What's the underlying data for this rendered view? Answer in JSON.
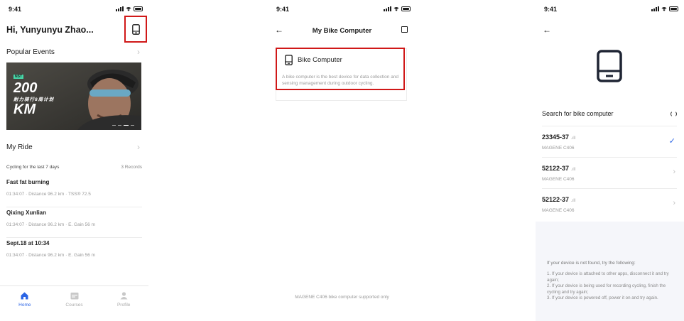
{
  "status": {
    "time": "9:41"
  },
  "home": {
    "greeting": "Hi, Yunyunyu Zhao...",
    "device_button_icon": "phone-device-icon",
    "popular_events": "Popular Events",
    "banner": {
      "tag": "NST",
      "big1": "200",
      "sub": "耐力骑行8周计划",
      "big2": "KM"
    },
    "my_ride": "My Ride",
    "cycling_summary": "Cycling for the last 7 days",
    "records": "3 Records",
    "rides": [
      {
        "title": "Fast fat burning",
        "detail": "01:34:07 · Distance 96.2 km · TSS® 72.5"
      },
      {
        "title": "Qixing Xunlian",
        "detail": "01:34:07 · Distance 96.2 km · E. Gain 56 m"
      },
      {
        "title": "Sept.18 at 10:34",
        "detail": "01:34:07 · Distance 96.2 km · E. Gain 56 m"
      }
    ],
    "tabs": [
      {
        "label": "Home",
        "icon": "home-icon"
      },
      {
        "label": "Courses",
        "icon": "calendar-icon"
      },
      {
        "label": "Profile",
        "icon": "profile-icon"
      }
    ]
  },
  "computer": {
    "title": "My Bike Computer",
    "card_title": "Bike Computer",
    "card_desc": "A bike computer is the best device for data collection and sensing management during outdoor cycling.",
    "footer": "MAGENE C406 bike computer supported only"
  },
  "search": {
    "label": "Search for bike computer",
    "devices": [
      {
        "id": "23345-37",
        "model": "MAGENE C406",
        "selected": true
      },
      {
        "id": "52122-37",
        "model": "MAGENE C406",
        "selected": false
      },
      {
        "id": "52122-37",
        "model": "MAGENE C406",
        "selected": false
      }
    ],
    "help_title": "If your device is not found, try the following:",
    "help_lines": [
      "1. If your device is attached to other apps, disconnect it and try again;",
      "2. If your device is being used for recording cycling, finish the cycling and try again;",
      "3. If your device is powered off, power it on and try again."
    ]
  }
}
